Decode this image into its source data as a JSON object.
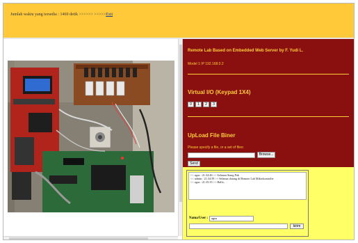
{
  "banner": {
    "time_text": "Jumlah waktu yang tersedia : 1469 detik >>>>>> >>>>>",
    "exit_link": "Exit"
  },
  "colors": {
    "banner": "#ffc93a",
    "panel": "#8a0f0f",
    "panel_text": "#ffcf38",
    "chat_bg": "#ffff66"
  },
  "camera": {
    "icon": "lab-board-photo"
  },
  "panel": {
    "title": "Remote Lab Based on Embedded Web Server by F. Yudi L.",
    "model": "Model 1 IP 192.168.0.2",
    "virtual_io": {
      "heading": "Virtual I/O (Keypad 1X4)",
      "keys": [
        "0",
        "1",
        "2",
        "3"
      ]
    },
    "upload": {
      "heading": "UpLoad File Biner",
      "note": "Please specify a file, or a set of files:",
      "browse_label": "Browse...",
      "send_label": "Send"
    }
  },
  "chat": {
    "messages": [
      "<< agus : 21:34:46 >> Selamat Siang Pak",
      "<< admin : 21:34:59 >> Selamat datang di Remote Lab Mikrokontroler",
      "<< agus : 21:35:35 >> Hallo,"
    ],
    "name_label": "Nama/User :",
    "name_value": "agus",
    "message_value": "",
    "kirim_label": "kirim"
  }
}
